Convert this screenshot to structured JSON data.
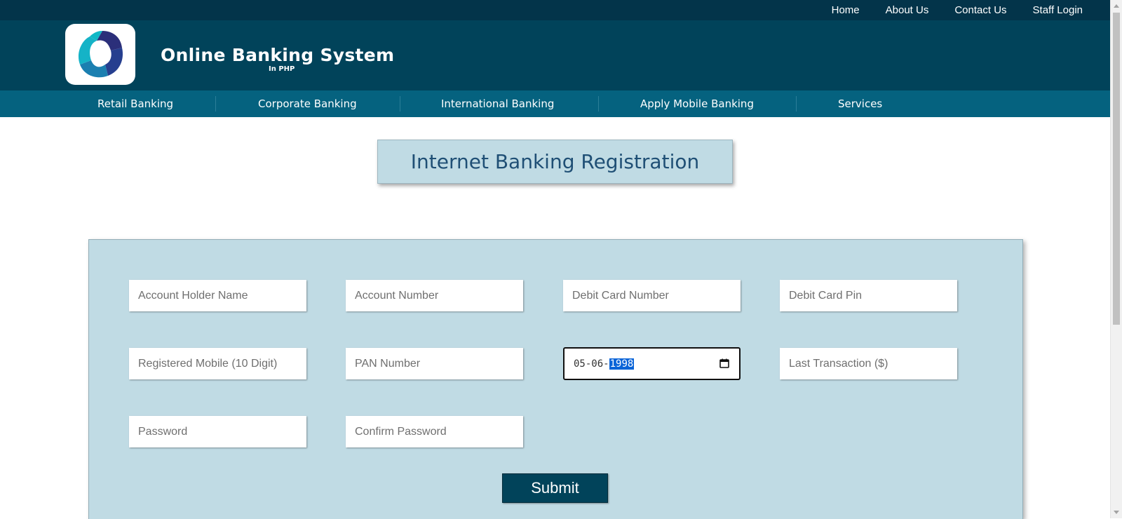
{
  "top_nav": {
    "home": "Home",
    "about": "About Us",
    "contact": "Contact Us",
    "staff_login": "Staff Login"
  },
  "header": {
    "title": "Online Banking System",
    "subtitle": "In PHP"
  },
  "main_nav": {
    "items": [
      "Retail Banking",
      "Corporate Banking",
      "International Banking",
      "Apply Mobile Banking",
      "Services"
    ]
  },
  "page": {
    "title": "Internet Banking Registration"
  },
  "form": {
    "account_holder_name": {
      "placeholder": "Account Holder Name"
    },
    "account_number": {
      "placeholder": "Account Number"
    },
    "debit_card_number": {
      "placeholder": "Debit Card Number"
    },
    "debit_card_pin": {
      "placeholder": "Debit Card Pin"
    },
    "registered_mobile": {
      "placeholder": "Registered Mobile (10 Digit)"
    },
    "pan_number": {
      "placeholder": "PAN Number"
    },
    "dob": {
      "day": "05",
      "month": "06",
      "year": "1998",
      "separator": "-"
    },
    "last_transaction": {
      "placeholder": "Last Transaction ($)"
    },
    "password": {
      "placeholder": "Password"
    },
    "confirm_password": {
      "placeholder": "Confirm Password"
    },
    "submit_label": "Submit"
  },
  "colors": {
    "topbar": "#03344a",
    "header": "#01435a",
    "nav": "#05627f",
    "panel": "#c0dbe4",
    "title_text": "#1f4f75",
    "selection": "#0a64d8"
  },
  "icons": {
    "logo": "bank-logo-icon",
    "calendar": "calendar-icon"
  }
}
